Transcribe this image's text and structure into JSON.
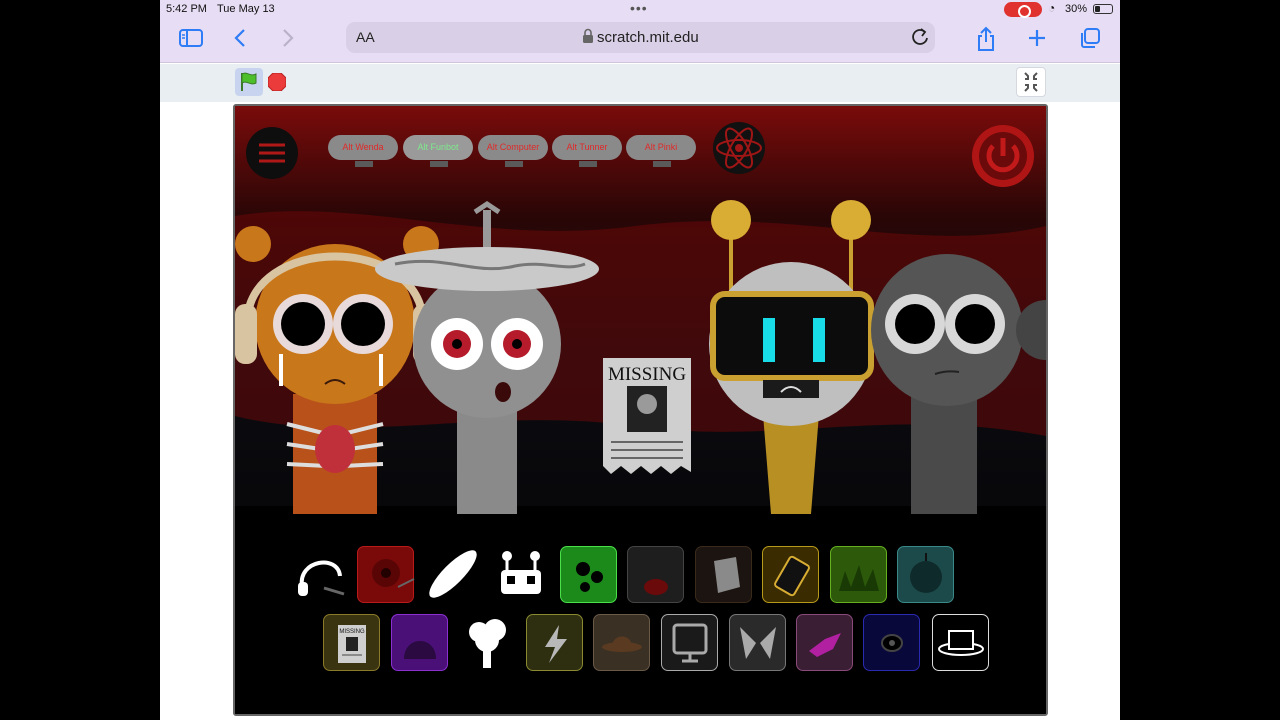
{
  "status_bar": {
    "time": "5:42 PM",
    "date": "Tue May 13",
    "battery": "30%"
  },
  "browser": {
    "text_size_label": "AA",
    "url": "scratch.mit.edu"
  },
  "game": {
    "alt_buttons": [
      {
        "label": "Alt Wenda",
        "active": false
      },
      {
        "label": "Alt Funbot",
        "active": true
      },
      {
        "label": "Alt Computer",
        "active": false
      },
      {
        "label": "Alt Tunner",
        "active": false
      },
      {
        "label": "Alt Pinki",
        "active": false
      }
    ],
    "poster_title": "MISSING",
    "top_row_icons": [
      "headphones-icon",
      "red-eye-blob-icon",
      "hat-brim-icon",
      "antenna-robot-icon",
      "green-slime-icon",
      "dark-face-icon",
      "rock-icon",
      "phone-icon",
      "grass-icon",
      "teal-orb-icon"
    ],
    "bottom_row_icons": [
      "missing-poster-icon",
      "purple-hair-icon",
      "tree-icon",
      "lightning-icon",
      "brown-hat-icon",
      "monitor-icon",
      "gray-ears-icon",
      "pink-bow-icon",
      "blue-eye-icon",
      "top-hat-icon"
    ],
    "poster_icon_label": "MISSING"
  },
  "colors": {
    "accent": "#2e7cf6",
    "stage_red": "#8c0e0e",
    "alt_active_text": "#7dea8c",
    "alt_text": "#e02a2a"
  }
}
